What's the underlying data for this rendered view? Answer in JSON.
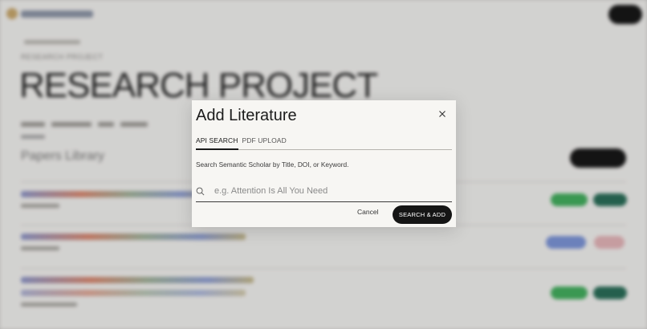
{
  "background": {
    "subtitle": "RESEARCH PROJECT",
    "page_title": "RESEARCH PROJECT",
    "section_title": "Papers Library"
  },
  "modal": {
    "title": "Add Literature",
    "tabs": [
      {
        "label": "API SEARCH",
        "active": true
      },
      {
        "label": "PDF UPLOAD",
        "active": false
      }
    ],
    "helper_text": "Search Semantic Scholar by Title, DOI, or Keyword.",
    "search": {
      "placeholder": "e.g. Attention Is All You Need",
      "value": ""
    },
    "cancel_label": "Cancel",
    "submit_label": "SEARCH & ADD"
  },
  "colors": {
    "primary_button": "#151515",
    "modal_background": "#f7f6f3",
    "status_green": "#3fae5b",
    "status_teal": "#256b55",
    "status_blue": "#7a93d8",
    "status_pink": "#e5b4b8"
  },
  "icons": {
    "close": "close-icon",
    "search": "search-icon"
  }
}
